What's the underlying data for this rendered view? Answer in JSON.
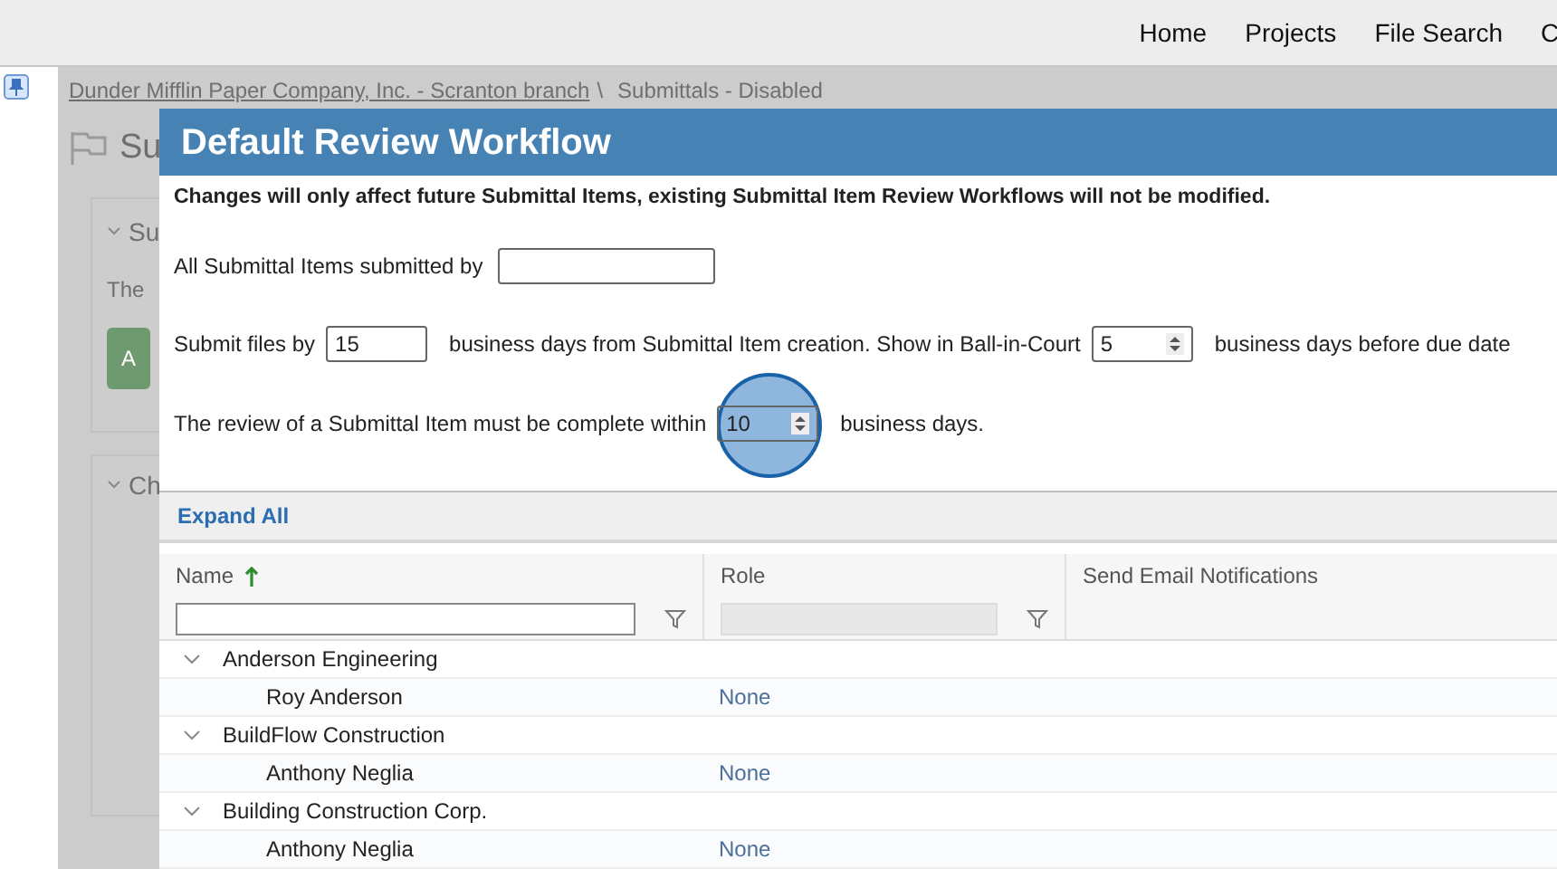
{
  "nav": [
    "Home",
    "Projects",
    "File Search",
    "C"
  ],
  "breadcrumb": {
    "link": "Dunder Mifflin Paper Company, Inc. - Scranton branch",
    "separator": "\\",
    "current": "Submittals - Disabled"
  },
  "page_title": "Su",
  "cards": [
    {
      "title": "Su",
      "text": "The",
      "button": "A"
    },
    {
      "title": "Ch"
    }
  ],
  "dialog": {
    "title": "Default Review Workflow",
    "notice": "Changes will only affect future Submittal Items, existing Submittal Item Review Workflows will not be modified.",
    "lines": [
      [
        {
          "kind": "text",
          "text": "All Submittal Items submitted by"
        },
        {
          "kind": "name_input"
        }
      ],
      [
        {
          "kind": "text",
          "text": "Submit files by"
        },
        {
          "kind": "input",
          "value": "15"
        },
        {
          "kind": "text",
          "text": "business days from Submittal Item creation. Show in Ball-in-Court"
        },
        {
          "kind": "spinner",
          "value": "5"
        },
        {
          "kind": "text",
          "text": "business days before due date"
        }
      ],
      [
        {
          "kind": "text",
          "text": "The review of a Submittal Item must be complete within"
        },
        {
          "kind": "spinner",
          "value": "10",
          "clicked": true
        },
        {
          "kind": "text",
          "text": "business days."
        }
      ]
    ],
    "expand_all": "Expand All",
    "table": {
      "columns": [
        {
          "label": "Name",
          "sort_ascending": true,
          "filter": {
            "disabled": false
          }
        },
        {
          "label": "Role",
          "filter": {
            "disabled": true
          }
        },
        {
          "label": "Send Email Notifications"
        }
      ],
      "rows": [
        {
          "name": "Anderson Engineering",
          "expanded": true,
          "children": [
            {
              "name": "Roy Anderson",
              "role": "None"
            }
          ]
        },
        {
          "name": "BuildFlow Construction",
          "expanded": true,
          "children": [
            {
              "name": "Anthony Neglia",
              "role": "None"
            }
          ]
        },
        {
          "name": "Building Construction Corp.",
          "expanded": true,
          "children": [
            {
              "name": "Anthony Neglia",
              "role": "None"
            }
          ]
        }
      ]
    }
  }
}
